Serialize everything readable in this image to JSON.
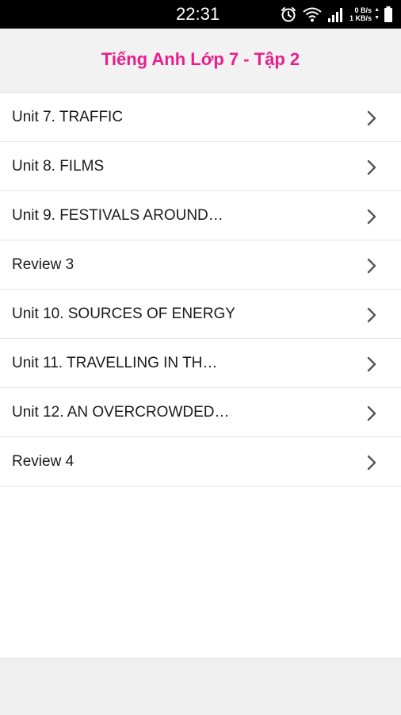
{
  "status_bar": {
    "time": "22:31",
    "net_up": "0 B/s",
    "net_down": "1 KB/s",
    "icons": [
      "alarm-icon",
      "wifi-icon",
      "signal-icon",
      "battery-icon"
    ]
  },
  "header": {
    "title": "Tiếng Anh Lớp 7 - Tập 2",
    "title_color": "#e91e8c"
  },
  "units": [
    {
      "label": "Unit 7. TRAFFIC",
      "icon": "chevron-right-icon"
    },
    {
      "label": "Unit 8. FILMS",
      "icon": "chevron-right-icon"
    },
    {
      "label": "Unit 9. FESTIVALS AROUND…",
      "icon": "chevron-right-icon"
    },
    {
      "label": "Review 3",
      "icon": "chevron-right-icon"
    },
    {
      "label": "Unit 10. SOURCES OF ENERGY",
      "icon": "chevron-right-icon"
    },
    {
      "label": "Unit 11. TRAVELLING IN TH…",
      "icon": "chevron-right-icon"
    },
    {
      "label": "Unit 12. AN OVERCROWDED…",
      "icon": "chevron-right-icon"
    },
    {
      "label": "Review 4",
      "icon": "chevron-right-icon"
    }
  ],
  "colors": {
    "accent": "#e91e8c",
    "chevron": "#555555",
    "header_bg": "#f2f2f2",
    "footer_bg": "#efefef"
  }
}
